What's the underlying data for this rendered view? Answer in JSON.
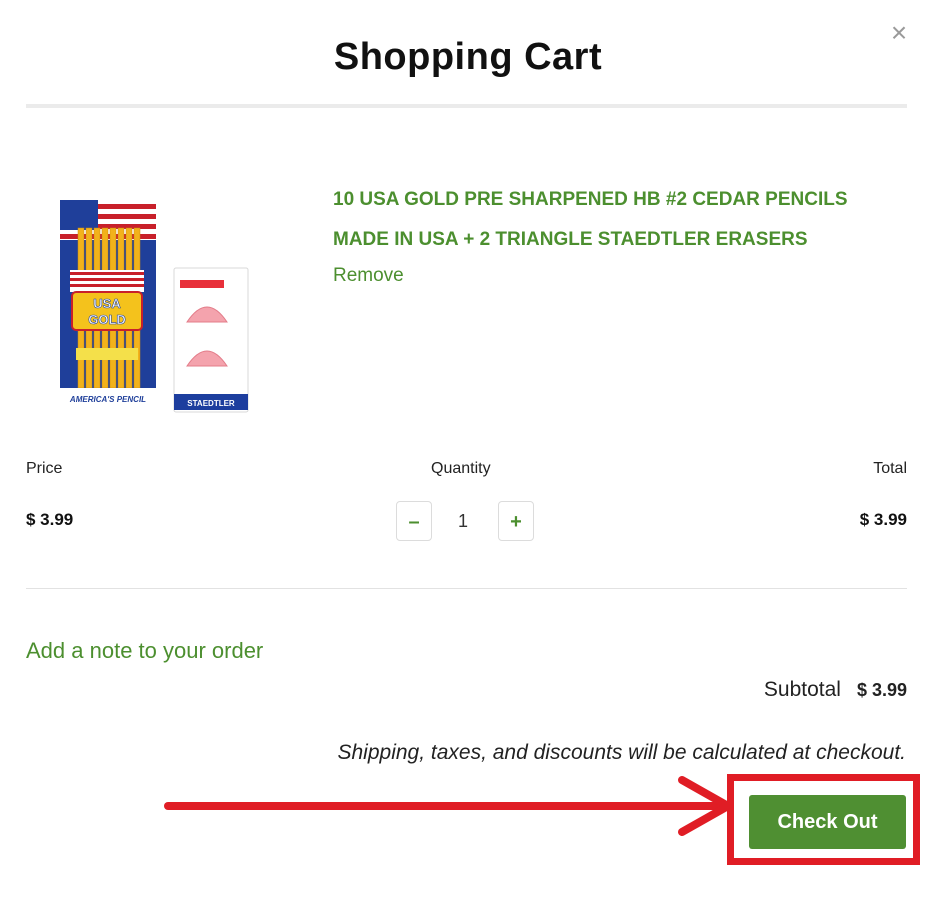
{
  "modal": {
    "title": "Shopping Cart",
    "close_glyph": "×"
  },
  "item": {
    "title_line1": "10 USA GOLD PRE SHARPENED HB #2 CEDAR PENCILS",
    "title_line2": "MADE IN USA + 2 TRIANGLE STAEDTLER ERASERS",
    "remove_label": "Remove",
    "image_text": {
      "brand": "USA GOLD",
      "tagline": "PREMIUM AMERICAN CEDAR PENCILS",
      "footer": "AMERICA'S PENCIL",
      "eraser_brand": "STAEDTLER"
    }
  },
  "columns": {
    "price_label": "Price",
    "quantity_label": "Quantity",
    "total_label": "Total"
  },
  "line": {
    "price": "$ 3.99",
    "quantity": "1",
    "total": "$ 3.99",
    "minus_glyph": "–",
    "plus_glyph": "+"
  },
  "footer": {
    "note_link": "Add a note to your order",
    "subtotal_label": "Subtotal",
    "subtotal_value": "$ 3.99",
    "shipping_note": "Shipping, taxes, and discounts will be calculated at checkout.",
    "checkout_label": "Check Out"
  },
  "colors": {
    "accent_green": "#4c8f2f",
    "checkout_green": "#4f8f32",
    "annotation_red": "#e01d25"
  },
  "icons": {
    "close": "close-icon",
    "minus": "minus-icon",
    "plus": "plus-icon",
    "annotation": "arrow-annotation"
  }
}
